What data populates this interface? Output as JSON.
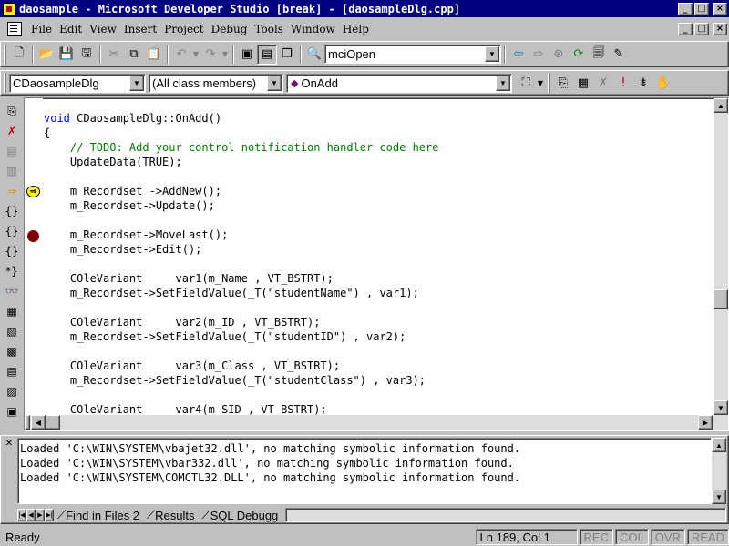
{
  "window": {
    "title": "daosample - Microsoft Developer Studio [break] - [daosampleDlg.cpp]",
    "controls": {
      "minimize": "_",
      "maximize": "□",
      "close": "×"
    }
  },
  "menu": {
    "items": [
      "File",
      "Edit",
      "View",
      "Insert",
      "Project",
      "Debug",
      "Tools",
      "Window",
      "Help"
    ]
  },
  "toolbar1": {
    "find_combo_value": "mciOpen"
  },
  "toolbar2": {
    "class_combo": "CDaosampleDlg",
    "members_combo": "(All class members)",
    "function_combo": "OnAdd"
  },
  "editor": {
    "lines": [
      {
        "k": "void",
        "t": " CDaosampleDlg::OnAdd()"
      },
      {
        "t": "{"
      },
      {
        "c": "    // TODO: Add your control notification handler code here"
      },
      {
        "t": "    UpdateData(TRUE);"
      },
      {
        "t": ""
      },
      {
        "t": "    m_Recordset ->AddNew();"
      },
      {
        "t": "    m_Recordset->Update();"
      },
      {
        "t": ""
      },
      {
        "t": "    m_Recordset->MoveLast();"
      },
      {
        "t": "    m_Recordset->Edit();"
      },
      {
        "t": ""
      },
      {
        "t": "    COleVariant     var1(m_Name , VT_BSTRT);"
      },
      {
        "t": "    m_Recordset->SetFieldValue(_T(\"studentName\") , var1);"
      },
      {
        "t": ""
      },
      {
        "t": "    COleVariant     var2(m_ID , VT_BSTRT);"
      },
      {
        "t": "    m_Recordset->SetFieldValue(_T(\"studentID\") , var2);"
      },
      {
        "t": ""
      },
      {
        "t": "    COleVariant     var3(m_Class , VT_BSTRT);"
      },
      {
        "t": "    m_Recordset->SetFieldValue(_T(\"studentClass\") , var3);"
      },
      {
        "t": ""
      },
      {
        "t": "    COleVariant     var4(m_SID , VT_BSTRT);"
      }
    ],
    "colors": {
      "keyword": "#0000ff",
      "comment": "#008000",
      "breakpoint": "#800000",
      "current_line": "#ffff00"
    }
  },
  "output": {
    "lines": [
      "Loaded 'C:\\WIN\\SYSTEM\\vbajet32.dll', no matching symbolic information found.",
      "Loaded 'C:\\WIN\\SYSTEM\\vbar332.dll', no matching symbolic information found.",
      "Loaded 'C:\\WIN\\SYSTEM\\COMCTL32.DLL', no matching symbolic information found."
    ],
    "tabs": [
      "Find in Files 2",
      "Results",
      "SQL Debugg"
    ]
  },
  "statusbar": {
    "ready": "Ready",
    "position": "Ln 189, Col 1",
    "rec": "REC",
    "col": "COL",
    "ovr": "OVR",
    "read": "READ"
  }
}
